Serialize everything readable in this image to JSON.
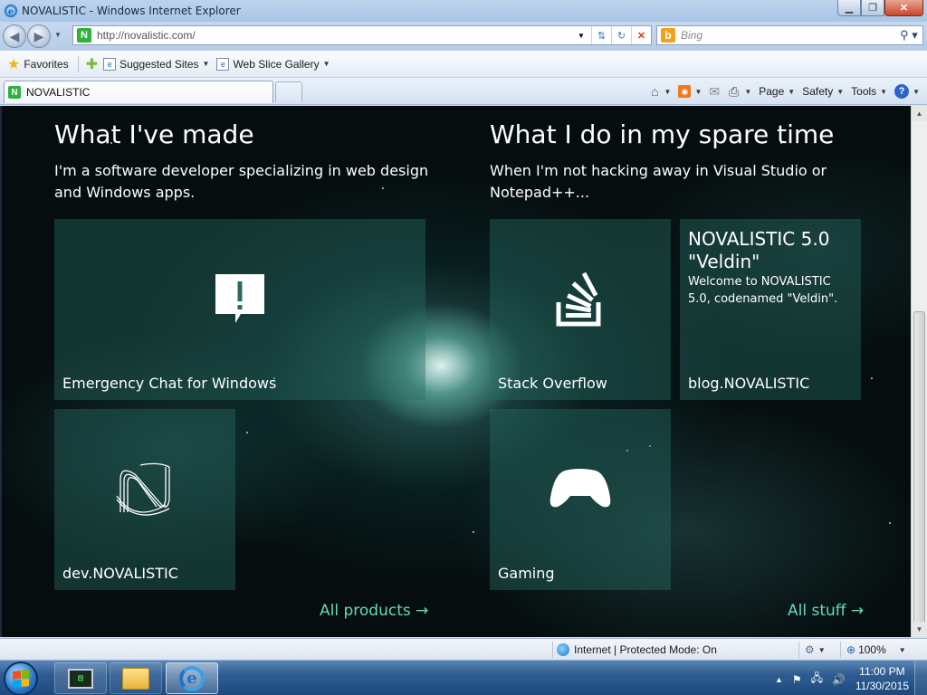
{
  "window": {
    "title": "NOVALISTIC - Windows Internet Explorer",
    "minimize": "▁",
    "restore": "❐",
    "close": "✕"
  },
  "address": {
    "url": "http://novalistic.com/",
    "favicon": "N",
    "search_placeholder": "Bing",
    "search_engine_icon": "b"
  },
  "favorites_bar": {
    "favorites_label": "Favorites",
    "suggested_sites_label": "Suggested Sites",
    "web_slice_label": "Web Slice Gallery"
  },
  "tab": {
    "label": "NOVALISTIC"
  },
  "command_bar": {
    "page_label": "Page",
    "safety_label": "Safety",
    "tools_label": "Tools",
    "help_label": "?"
  },
  "page": {
    "left": {
      "heading": "What I've made",
      "subheading": "I'm a software developer specializing in web design and Windows apps.",
      "tiles": [
        {
          "label": "Emergency Chat for Windows",
          "icon": "alert-bubble-icon"
        },
        {
          "label": "dev.NOVALISTIC",
          "icon": "novalistic-logo-icon"
        }
      ],
      "more_link": "All products →"
    },
    "right": {
      "heading": "What I do in my spare time",
      "subheading": "When I'm not hacking away in Visual Studio or Notepad++...",
      "tiles": [
        {
          "label": "Stack Overflow",
          "icon": "stack-overflow-icon"
        },
        {
          "label": "blog.NOVALISTIC",
          "heading": "NOVALISTIC 5.0 \"Veldin\"",
          "body": "Welcome to NOVALISTIC 5.0, codenamed \"Veldin\"."
        },
        {
          "label": "Gaming",
          "icon": "xbox-controller-icon"
        }
      ],
      "more_link": "All stuff →"
    },
    "accent_color": "#66d9c0"
  },
  "status_bar": {
    "zone": "Internet | Protected Mode: On",
    "zoom": "100%"
  },
  "taskbar": {
    "time": "11:00 PM",
    "date": "11/30/2015"
  }
}
